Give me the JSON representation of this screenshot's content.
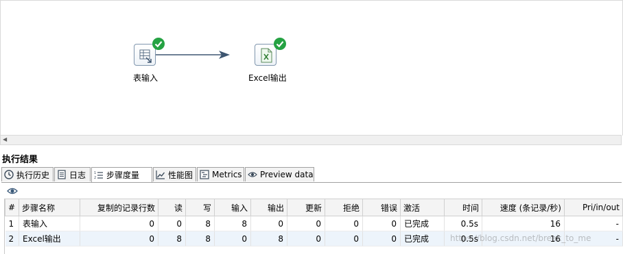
{
  "canvas": {
    "nodes": [
      {
        "label": "表输入",
        "icon": "table-input-icon",
        "status": "done-check"
      },
      {
        "label": "Excel输出",
        "icon": "excel-output-icon",
        "status": "done-check"
      }
    ]
  },
  "results": {
    "title": "执行结果",
    "tabs": [
      {
        "label": "执行历史",
        "icon": "clock-icon"
      },
      {
        "label": "日志",
        "icon": "log-icon"
      },
      {
        "label": "步骤度量",
        "icon": "step-metrics-icon"
      },
      {
        "label": "性能图",
        "icon": "performance-chart-icon"
      },
      {
        "label": "Metrics",
        "icon": "metrics-icon"
      },
      {
        "label": "Preview data",
        "icon": "eye-icon"
      }
    ],
    "active_tab": "步骤度量",
    "table": {
      "headers": [
        "#",
        "步骤名称",
        "复制的记录行数",
        "读",
        "写",
        "输入",
        "输出",
        "更新",
        "拒绝",
        "错误",
        "激活",
        "时间",
        "速度 (条记录/秒)",
        "Pri/in/out"
      ],
      "rows": [
        [
          "1",
          "表输入",
          "0",
          "0",
          "8",
          "8",
          "0",
          "0",
          "0",
          "0",
          "已完成",
          "0.5s",
          "16",
          "-"
        ],
        [
          "2",
          "Excel输出",
          "0",
          "8",
          "8",
          "0",
          "8",
          "0",
          "0",
          "0",
          "已完成",
          "0.5s",
          "16",
          "-"
        ]
      ]
    }
  },
  "watermark": "https://blog.csdn.net/break_to_me",
  "colors": {
    "check": "#25a243",
    "hop": "#3d5570",
    "selected_row": "#edf4fb"
  }
}
